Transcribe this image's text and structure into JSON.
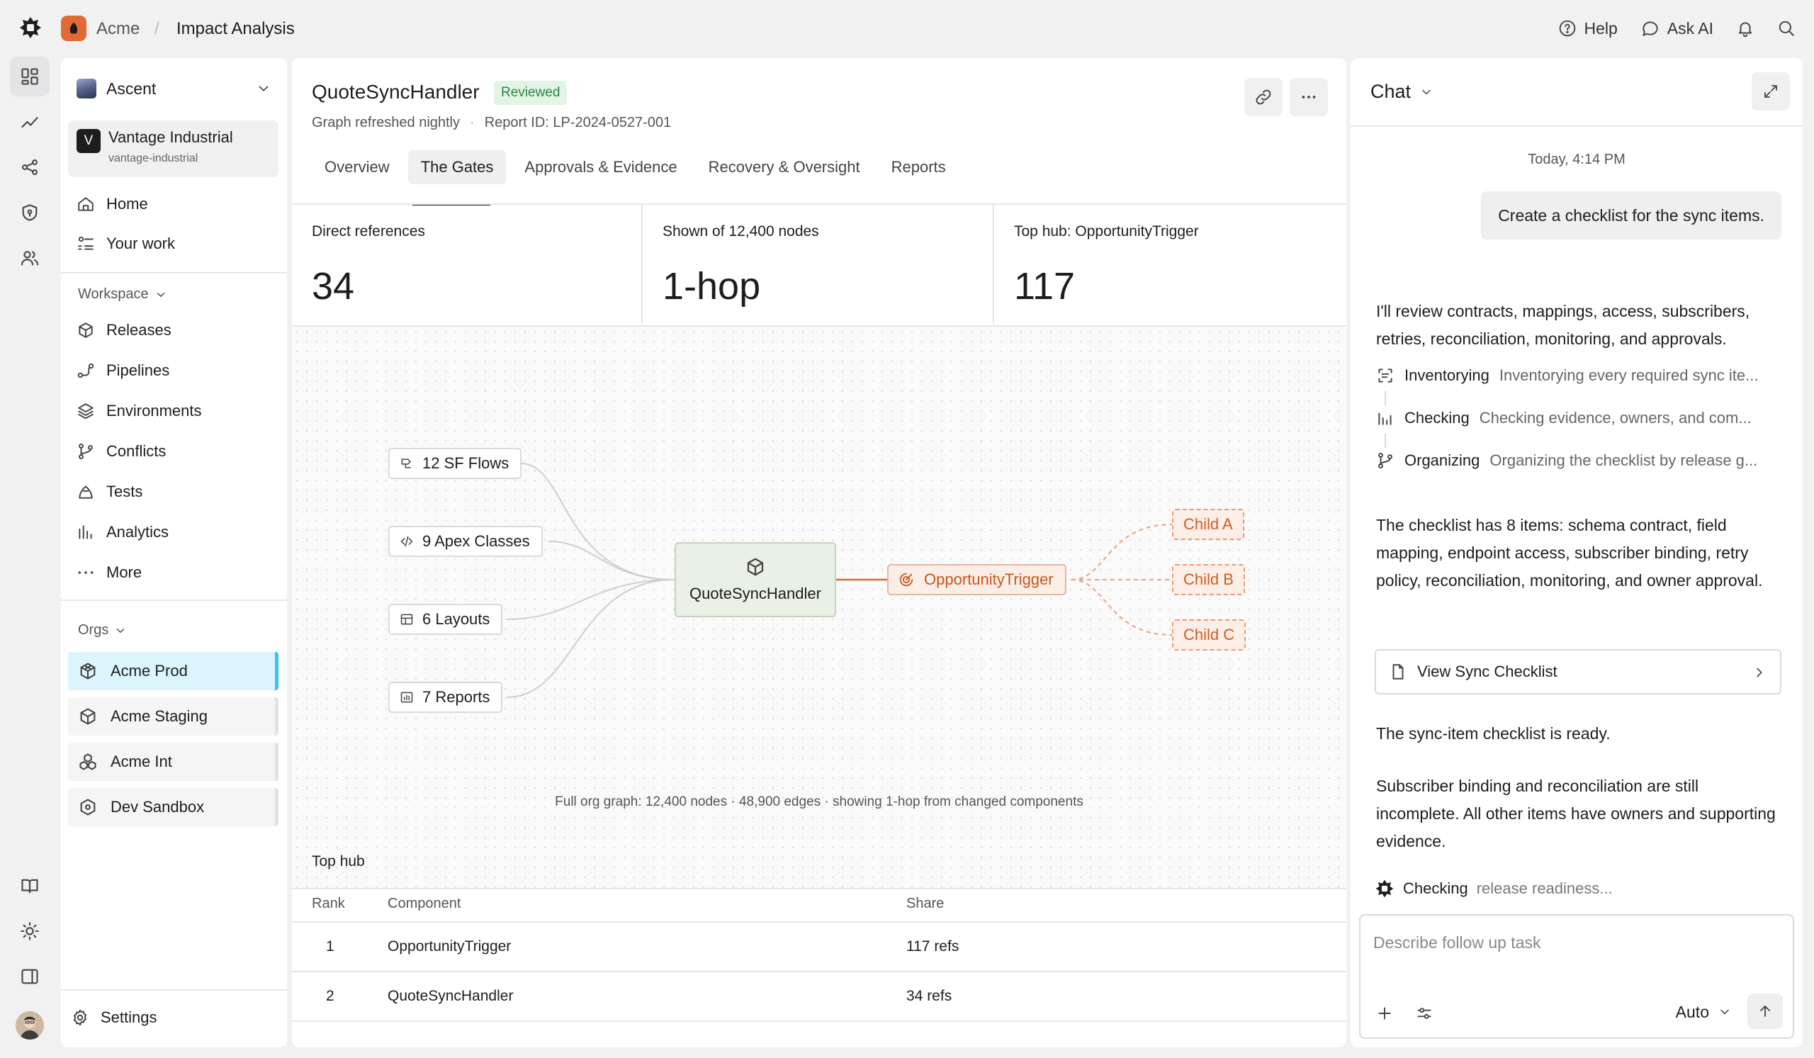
{
  "topbar": {
    "org": "Acme",
    "separator": "/",
    "page": "Impact Analysis",
    "help": "Help",
    "ask_ai": "Ask AI"
  },
  "sidebar": {
    "workspace_name": "Ascent",
    "org_card": {
      "badge": "V",
      "name": "Vantage Industrial",
      "slug": "vantage-industrial"
    },
    "primary": [
      {
        "label": "Home",
        "icon": "home-icon"
      },
      {
        "label": "Your work",
        "icon": "list-icon"
      }
    ],
    "workspace_header": "Workspace",
    "workspace_items": [
      {
        "label": "Releases",
        "icon": "package-icon"
      },
      {
        "label": "Pipelines",
        "icon": "pipeline-icon"
      },
      {
        "label": "Environments",
        "icon": "layers-icon"
      },
      {
        "label": "Conflicts",
        "icon": "branch-icon"
      },
      {
        "label": "Tests",
        "icon": "flask-icon"
      },
      {
        "label": "Analytics",
        "icon": "bars-icon"
      },
      {
        "label": "More",
        "icon": "more-icon"
      }
    ],
    "orgs_header": "Orgs",
    "orgs": [
      {
        "label": "Acme Prod",
        "active": true
      },
      {
        "label": "Acme Staging",
        "active": false
      },
      {
        "label": "Acme Int",
        "active": false
      },
      {
        "label": "Dev Sandbox",
        "active": false
      }
    ],
    "settings": "Settings"
  },
  "main": {
    "title": "QuoteSyncHandler",
    "badge": "Reviewed",
    "refresh": "Graph refreshed nightly",
    "dot": "·",
    "report_id": "Report ID: LP-2024-0527-001",
    "tabs": [
      {
        "label": "Overview",
        "active": false
      },
      {
        "label": "The Gates",
        "active": true
      },
      {
        "label": "Approvals & Evidence",
        "active": false
      },
      {
        "label": "Recovery & Oversight",
        "active": false
      },
      {
        "label": "Reports",
        "active": false
      }
    ],
    "stats": [
      {
        "label": "Direct references",
        "value": "34"
      },
      {
        "label": "Shown of 12,400 nodes",
        "value": "1-hop"
      },
      {
        "label": "Top hub: OpportunityTrigger",
        "value": "117"
      }
    ],
    "graph": {
      "inputs": [
        {
          "label": "12 SF Flows",
          "icon": "flow-icon"
        },
        {
          "label": "9 Apex Classes",
          "icon": "code-icon"
        },
        {
          "label": "6 Layouts",
          "icon": "layout-icon"
        },
        {
          "label": "7 Reports",
          "icon": "report-icon"
        }
      ],
      "center": "QuoteSyncHandler",
      "hub": "OpportunityTrigger",
      "children": [
        "Child A",
        "Child B",
        "Child C"
      ],
      "caption": "Full org graph: 12,400 nodes · 48,900 edges · showing 1-hop from changed components"
    },
    "table": {
      "title": "Top hub",
      "columns": [
        "Rank",
        "Component",
        "Share"
      ],
      "rows": [
        {
          "rank": "1",
          "component": "OpportunityTrigger",
          "share": "117 refs"
        },
        {
          "rank": "2",
          "component": "QuoteSyncHandler",
          "share": "34 refs"
        }
      ]
    }
  },
  "chat": {
    "title": "Chat",
    "timestamp": "Today, 4:14 PM",
    "user_message": "Create a checklist for the sync items.",
    "reply_intro": "I'll review contracts, mappings, access, subscribers, retries, reconciliation, monitoring, and approvals.",
    "steps": [
      {
        "name": "Inventorying",
        "desc": "Inventorying every required sync ite...",
        "icon": "scan-icon"
      },
      {
        "name": "Checking",
        "desc": "Checking evidence, owners, and com...",
        "icon": "bars-icon"
      },
      {
        "name": "Organizing",
        "desc": "Organizing the checklist by release g...",
        "icon": "branch-icon"
      }
    ],
    "reply_summary": "The checklist has 8 items: schema contract, field mapping, endpoint access, subscriber binding, retry policy, reconciliation, monitoring, and owner approval.",
    "checklist_link": "View Sync Checklist",
    "ready": "The sync-item checklist is ready.",
    "incomplete": "Subscriber binding and reconciliation are still incomplete. All other items have owners and supporting evidence.",
    "status_prefix": "Checking",
    "status_rest": "release readiness...",
    "composer": {
      "placeholder": "Describe follow up task",
      "value": "",
      "mode": "Auto"
    }
  },
  "colors": {
    "accent": "#36c3f0",
    "active_org_bg": "#dcf5fd",
    "reviewed_bg": "#e2f4e5",
    "reviewed_text": "#2e8540",
    "hub_text": "#c8561e",
    "center_node_bg": "#e9f0e5"
  }
}
